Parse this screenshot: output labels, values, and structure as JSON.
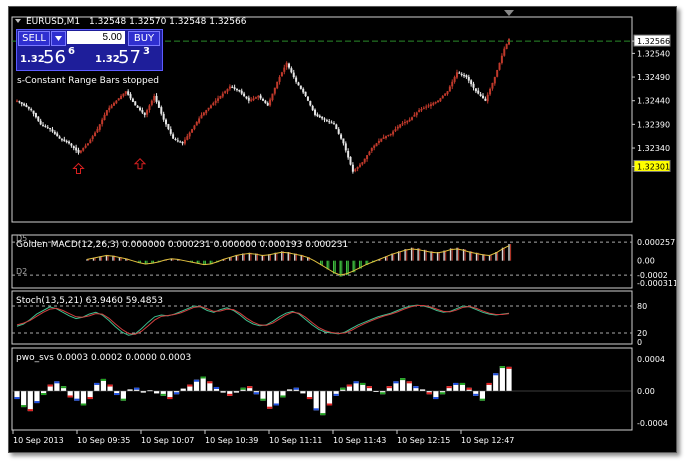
{
  "window": {
    "title": "EURUSD,M1",
    "ohlc": "1.32548 1.32570 1.32548 1.32566"
  },
  "trade_panel": {
    "sell_label": "SELL",
    "buy_label": "BUY",
    "lot_value": "5.00",
    "sell_small": "1.32",
    "sell_big": "56",
    "sell_sup": "6",
    "buy_small": "1.32",
    "buy_big": "57",
    "buy_sup": "3"
  },
  "status_text": "s-Constant Range Bars stopped",
  "colors": {
    "background": "#000000",
    "bull": "#c0392b",
    "bear": "#e8e8e8",
    "bid_line": "#2a8a2a",
    "current_price_bg": "#ffffff",
    "current_price_marker": "#ffff00"
  },
  "panels": {
    "macd": {
      "label": "Golden MACD(12,26,3) 0.000000 0.000231 0.000000 0.000193 0.000231",
      "level_up_label": "D5",
      "level_dn_label": "D2"
    },
    "stoch": {
      "label": "Stoch(13,5,21) 63.9460 59.4853"
    },
    "pwo": {
      "label": "pwo_svs 0.0003 0.0002 0.0000 0.0003"
    }
  },
  "x_axis_labels": [
    "10 Sep 2013",
    "10 Sep 09:35",
    "10 Sep 10:07",
    "10 Sep 10:39",
    "10 Sep 11:11",
    "10 Sep 11:43",
    "10 Sep 12:15",
    "10 Sep 12:47"
  ],
  "chart_data": [
    {
      "type": "candlestick",
      "title": "EURUSD,M1",
      "ylim": [
        1.3219,
        1.326
      ],
      "y_ticks": [
        "1.32566",
        "1.32540",
        "1.32490",
        "1.32440",
        "1.32390",
        "1.32340",
        "1.32301"
      ],
      "current_price": 1.32566,
      "low_marker": 1.32301,
      "close_path": [
        [
          0,
          1.3244
        ],
        [
          6,
          1.3242
        ],
        [
          10,
          1.3239
        ],
        [
          14,
          1.3238
        ],
        [
          18,
          1.3236
        ],
        [
          22,
          1.3235
        ],
        [
          26,
          1.3233
        ],
        [
          30,
          1.3235
        ],
        [
          34,
          1.3238
        ],
        [
          38,
          1.3242
        ],
        [
          42,
          1.3244
        ],
        [
          46,
          1.3246
        ],
        [
          50,
          1.3243
        ],
        [
          54,
          1.3241
        ],
        [
          58,
          1.3245
        ],
        [
          62,
          1.324
        ],
        [
          66,
          1.3236
        ],
        [
          70,
          1.3235
        ],
        [
          74,
          1.3238
        ],
        [
          78,
          1.3241
        ],
        [
          82,
          1.3243
        ],
        [
          86,
          1.3245
        ],
        [
          90,
          1.3247
        ],
        [
          94,
          1.3246
        ],
        [
          98,
          1.3244
        ],
        [
          102,
          1.3245
        ],
        [
          106,
          1.3243
        ],
        [
          110,
          1.3248
        ],
        [
          114,
          1.3252
        ],
        [
          118,
          1.3248
        ],
        [
          122,
          1.3245
        ],
        [
          126,
          1.3241
        ],
        [
          130,
          1.324
        ],
        [
          134,
          1.3239
        ],
        [
          138,
          1.3235
        ],
        [
          142,
          1.3229
        ],
        [
          146,
          1.3231
        ],
        [
          150,
          1.3234
        ],
        [
          154,
          1.3236
        ],
        [
          158,
          1.3237
        ],
        [
          162,
          1.3239
        ],
        [
          166,
          1.324
        ],
        [
          170,
          1.3242
        ],
        [
          174,
          1.3243
        ],
        [
          178,
          1.3244
        ],
        [
          182,
          1.3246
        ],
        [
          186,
          1.325
        ],
        [
          190,
          1.3249
        ],
        [
          194,
          1.3246
        ],
        [
          198,
          1.3244
        ],
        [
          202,
          1.3249
        ],
        [
          206,
          1.3255
        ],
        [
          208,
          1.3257
        ]
      ],
      "up_arrows": [
        [
          26,
          1.3232
        ],
        [
          52,
          1.3233
        ]
      ]
    },
    {
      "type": "histogram+line",
      "title": "Golden MACD(12,26,3)",
      "ylim": [
        -0.00035,
        0.0003
      ],
      "y_ticks": [
        "0.000257",
        "0.00",
        "-0.0002",
        "-0.000311"
      ],
      "values": [
        2e-05,
        4e-05,
        6e-05,
        8e-05,
        7e-05,
        5e-05,
        3e-05,
        0.0,
        -3e-05,
        -5e-05,
        -4e-05,
        -2e-05,
        1e-05,
        3e-05,
        2e-05,
        0.0,
        -2e-05,
        -4e-05,
        -6e-05,
        -5e-05,
        -2e-05,
        2e-05,
        5e-05,
        8e-05,
        0.0001,
        0.00011,
        0.0001,
        8e-05,
        9e-05,
        0.00011,
        0.00013,
        0.00012,
        0.0001,
        8e-05,
        5e-05,
        0.0,
        -6e-05,
        -0.00012,
        -0.00018,
        -0.00022,
        -0.0002,
        -0.00016,
        -0.00011,
        -6e-05,
        -2e-05,
        2e-05,
        6e-05,
        0.0001,
        0.00013,
        0.00016,
        0.00018,
        0.00017,
        0.00015,
        0.00013,
        0.00012,
        0.00014,
        0.00017,
        0.00018,
        0.00016,
        0.00013,
        0.00011,
        9e-05,
        8e-05,
        0.00012,
        0.00018,
        0.00023
      ]
    },
    {
      "type": "line",
      "title": "Stoch(13,5,21)",
      "ylim": [
        0,
        100
      ],
      "y_ticks": [
        "80",
        "20",
        "0"
      ],
      "series": [
        {
          "name": "main",
          "values": [
            35,
            40,
            50,
            62,
            70,
            78,
            74,
            66,
            58,
            52,
            55,
            62,
            66,
            60,
            48,
            34,
            22,
            15,
            18,
            30,
            44,
            56,
            60,
            58,
            62,
            68,
            74,
            80,
            78,
            70,
            66,
            72,
            76,
            70,
            60,
            48,
            40,
            36,
            38,
            46,
            56,
            64,
            68,
            62,
            50,
            38,
            28,
            22,
            20,
            18,
            22,
            30,
            38,
            44,
            50,
            56,
            60,
            64,
            70,
            76,
            80,
            82,
            80,
            76,
            70,
            66,
            68,
            74,
            80,
            78,
            72,
            66,
            62,
            60,
            62,
            64
          ]
        },
        {
          "name": "signal",
          "values": [
            38,
            42,
            48,
            57,
            66,
            73,
            75,
            70,
            63,
            56,
            55,
            58,
            63,
            62,
            53,
            40,
            28,
            19,
            17,
            24,
            36,
            49,
            57,
            59,
            61,
            65,
            71,
            77,
            79,
            74,
            68,
            69,
            73,
            72,
            64,
            53,
            44,
            38,
            37,
            42,
            51,
            60,
            66,
            64,
            55,
            43,
            32,
            25,
            21,
            19,
            20,
            26,
            34,
            41,
            47,
            53,
            58,
            62,
            67,
            73,
            78,
            81,
            81,
            78,
            73,
            68,
            67,
            71,
            77,
            79,
            75,
            69,
            64,
            61,
            61,
            63
          ]
        }
      ]
    },
    {
      "type": "histogram",
      "title": "pwo_svs",
      "ylim": [
        -0.00046,
        0.00046
      ],
      "y_ticks": [
        "0.0004",
        "0.00",
        "-0.0004"
      ],
      "values": [
        -0.0001,
        -0.0002,
        -0.00025,
        -0.00015,
        -5e-05,
        8e-05,
        0.00012,
        6e-05,
        -8e-05,
        -0.00012,
        -0.00018,
        -0.0001,
        0.0001,
        0.00015,
        8e-05,
        -5e-05,
        -0.00012,
        2e-05,
        4e-05,
        -2e-05,
        1e-05,
        -3e-05,
        -6e-05,
        -0.0001,
        -4e-05,
        3e-05,
        8e-05,
        0.00014,
        0.00018,
        0.00012,
        5e-05,
        -2e-05,
        -6e-05,
        -2e-05,
        4e-05,
        6e-05,
        -4e-05,
        -0.00012,
        -0.00022,
        -0.00018,
        -8e-05,
        2e-05,
        4e-05,
        -3e-05,
        -0.0001,
        -0.00024,
        -0.0003,
        -0.00018,
        -6e-05,
        4e-05,
        8e-05,
        0.00012,
        0.0001,
        6e-05,
        0.0,
        -4e-05,
        6e-05,
        0.00012,
        0.00016,
        0.00012,
        6e-05,
        2e-05,
        -4e-05,
        -0.0001,
        -4e-05,
        6e-05,
        0.0001,
        0.0001,
        4e-05,
        -6e-05,
        -0.00012,
        0.0001,
        0.00022,
        0.00031,
        0.0003
      ]
    }
  ]
}
